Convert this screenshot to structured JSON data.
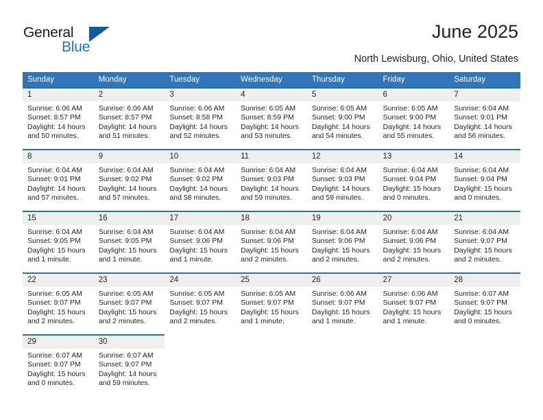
{
  "brand": {
    "name_part1": "General",
    "name_part2": "Blue"
  },
  "header": {
    "title": "June 2025",
    "location": "North Lewisburg, Ohio, United States"
  },
  "colors": {
    "header_blue": "#3275b8",
    "cell_top_border": "#2a6db0",
    "daynum_band": "#efefef",
    "brand_blue": "#1d71b8",
    "text": "#231f20"
  },
  "labels": {
    "sunrise_prefix": "Sunrise:",
    "sunset_prefix": "Sunset:",
    "daylight_prefix": "Daylight:"
  },
  "weekdays": [
    "Sunday",
    "Monday",
    "Tuesday",
    "Wednesday",
    "Thursday",
    "Friday",
    "Saturday"
  ],
  "weeks": [
    [
      {
        "day": "1",
        "sunrise": "Sunrise: 6:06 AM",
        "sunset": "Sunset: 8:57 PM",
        "daylight1": "Daylight: 14 hours",
        "daylight2": "and 50 minutes."
      },
      {
        "day": "2",
        "sunrise": "Sunrise: 6:06 AM",
        "sunset": "Sunset: 8:57 PM",
        "daylight1": "Daylight: 14 hours",
        "daylight2": "and 51 minutes."
      },
      {
        "day": "3",
        "sunrise": "Sunrise: 6:06 AM",
        "sunset": "Sunset: 8:58 PM",
        "daylight1": "Daylight: 14 hours",
        "daylight2": "and 52 minutes."
      },
      {
        "day": "4",
        "sunrise": "Sunrise: 6:05 AM",
        "sunset": "Sunset: 8:59 PM",
        "daylight1": "Daylight: 14 hours",
        "daylight2": "and 53 minutes."
      },
      {
        "day": "5",
        "sunrise": "Sunrise: 6:05 AM",
        "sunset": "Sunset: 9:00 PM",
        "daylight1": "Daylight: 14 hours",
        "daylight2": "and 54 minutes."
      },
      {
        "day": "6",
        "sunrise": "Sunrise: 6:05 AM",
        "sunset": "Sunset: 9:00 PM",
        "daylight1": "Daylight: 14 hours",
        "daylight2": "and 55 minutes."
      },
      {
        "day": "7",
        "sunrise": "Sunrise: 6:04 AM",
        "sunset": "Sunset: 9:01 PM",
        "daylight1": "Daylight: 14 hours",
        "daylight2": "and 56 minutes."
      }
    ],
    [
      {
        "day": "8",
        "sunrise": "Sunrise: 6:04 AM",
        "sunset": "Sunset: 9:01 PM",
        "daylight1": "Daylight: 14 hours",
        "daylight2": "and 57 minutes."
      },
      {
        "day": "9",
        "sunrise": "Sunrise: 6:04 AM",
        "sunset": "Sunset: 9:02 PM",
        "daylight1": "Daylight: 14 hours",
        "daylight2": "and 57 minutes."
      },
      {
        "day": "10",
        "sunrise": "Sunrise: 6:04 AM",
        "sunset": "Sunset: 9:02 PM",
        "daylight1": "Daylight: 14 hours",
        "daylight2": "and 58 minutes."
      },
      {
        "day": "11",
        "sunrise": "Sunrise: 6:04 AM",
        "sunset": "Sunset: 9:03 PM",
        "daylight1": "Daylight: 14 hours",
        "daylight2": "and 59 minutes."
      },
      {
        "day": "12",
        "sunrise": "Sunrise: 6:04 AM",
        "sunset": "Sunset: 9:03 PM",
        "daylight1": "Daylight: 14 hours",
        "daylight2": "and 59 minutes."
      },
      {
        "day": "13",
        "sunrise": "Sunrise: 6:04 AM",
        "sunset": "Sunset: 9:04 PM",
        "daylight1": "Daylight: 15 hours",
        "daylight2": "and 0 minutes."
      },
      {
        "day": "14",
        "sunrise": "Sunrise: 6:04 AM",
        "sunset": "Sunset: 9:04 PM",
        "daylight1": "Daylight: 15 hours",
        "daylight2": "and 0 minutes."
      }
    ],
    [
      {
        "day": "15",
        "sunrise": "Sunrise: 6:04 AM",
        "sunset": "Sunset: 9:05 PM",
        "daylight1": "Daylight: 15 hours",
        "daylight2": "and 1 minute."
      },
      {
        "day": "16",
        "sunrise": "Sunrise: 6:04 AM",
        "sunset": "Sunset: 9:05 PM",
        "daylight1": "Daylight: 15 hours",
        "daylight2": "and 1 minute."
      },
      {
        "day": "17",
        "sunrise": "Sunrise: 6:04 AM",
        "sunset": "Sunset: 9:06 PM",
        "daylight1": "Daylight: 15 hours",
        "daylight2": "and 1 minute."
      },
      {
        "day": "18",
        "sunrise": "Sunrise: 6:04 AM",
        "sunset": "Sunset: 9:06 PM",
        "daylight1": "Daylight: 15 hours",
        "daylight2": "and 2 minutes."
      },
      {
        "day": "19",
        "sunrise": "Sunrise: 6:04 AM",
        "sunset": "Sunset: 9:06 PM",
        "daylight1": "Daylight: 15 hours",
        "daylight2": "and 2 minutes."
      },
      {
        "day": "20",
        "sunrise": "Sunrise: 6:04 AM",
        "sunset": "Sunset: 9:06 PM",
        "daylight1": "Daylight: 15 hours",
        "daylight2": "and 2 minutes."
      },
      {
        "day": "21",
        "sunrise": "Sunrise: 6:04 AM",
        "sunset": "Sunset: 9:07 PM",
        "daylight1": "Daylight: 15 hours",
        "daylight2": "and 2 minutes."
      }
    ],
    [
      {
        "day": "22",
        "sunrise": "Sunrise: 6:05 AM",
        "sunset": "Sunset: 9:07 PM",
        "daylight1": "Daylight: 15 hours",
        "daylight2": "and 2 minutes."
      },
      {
        "day": "23",
        "sunrise": "Sunrise: 6:05 AM",
        "sunset": "Sunset: 9:07 PM",
        "daylight1": "Daylight: 15 hours",
        "daylight2": "and 2 minutes."
      },
      {
        "day": "24",
        "sunrise": "Sunrise: 6:05 AM",
        "sunset": "Sunset: 9:07 PM",
        "daylight1": "Daylight: 15 hours",
        "daylight2": "and 2 minutes."
      },
      {
        "day": "25",
        "sunrise": "Sunrise: 6:05 AM",
        "sunset": "Sunset: 9:07 PM",
        "daylight1": "Daylight: 15 hours",
        "daylight2": "and 1 minute."
      },
      {
        "day": "26",
        "sunrise": "Sunrise: 6:06 AM",
        "sunset": "Sunset: 9:07 PM",
        "daylight1": "Daylight: 15 hours",
        "daylight2": "and 1 minute."
      },
      {
        "day": "27",
        "sunrise": "Sunrise: 6:06 AM",
        "sunset": "Sunset: 9:07 PM",
        "daylight1": "Daylight: 15 hours",
        "daylight2": "and 1 minute."
      },
      {
        "day": "28",
        "sunrise": "Sunrise: 6:07 AM",
        "sunset": "Sunset: 9:07 PM",
        "daylight1": "Daylight: 15 hours",
        "daylight2": "and 0 minutes."
      }
    ],
    [
      {
        "day": "29",
        "sunrise": "Sunrise: 6:07 AM",
        "sunset": "Sunset: 9:07 PM",
        "daylight1": "Daylight: 15 hours",
        "daylight2": "and 0 minutes."
      },
      {
        "day": "30",
        "sunrise": "Sunrise: 6:07 AM",
        "sunset": "Sunset: 9:07 PM",
        "daylight1": "Daylight: 14 hours",
        "daylight2": "and 59 minutes."
      },
      {
        "day": "",
        "sunrise": "",
        "sunset": "",
        "daylight1": "",
        "daylight2": ""
      },
      {
        "day": "",
        "sunrise": "",
        "sunset": "",
        "daylight1": "",
        "daylight2": ""
      },
      {
        "day": "",
        "sunrise": "",
        "sunset": "",
        "daylight1": "",
        "daylight2": ""
      },
      {
        "day": "",
        "sunrise": "",
        "sunset": "",
        "daylight1": "",
        "daylight2": ""
      },
      {
        "day": "",
        "sunrise": "",
        "sunset": "",
        "daylight1": "",
        "daylight2": ""
      }
    ]
  ]
}
